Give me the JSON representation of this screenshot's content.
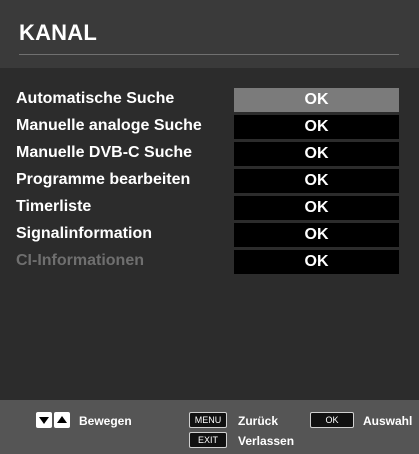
{
  "title": "KANAL",
  "menu": {
    "items": [
      {
        "label": "Automatische Suche",
        "action": "OK",
        "selected": true,
        "enabled": true
      },
      {
        "label": "Manuelle analoge Suche",
        "action": "OK",
        "selected": false,
        "enabled": true
      },
      {
        "label": "Manuelle DVB-C Suche",
        "action": "OK",
        "selected": false,
        "enabled": true
      },
      {
        "label": "Programme bearbeiten",
        "action": "OK",
        "selected": false,
        "enabled": true
      },
      {
        "label": "Timerliste",
        "action": "OK",
        "selected": false,
        "enabled": true
      },
      {
        "label": "Signalinformation",
        "action": "OK",
        "selected": false,
        "enabled": true
      },
      {
        "label": "CI-Informationen",
        "action": "OK",
        "selected": false,
        "enabled": false
      }
    ]
  },
  "footer": {
    "move_label": "Bewegen",
    "menu_key": "MENU",
    "back_label": "Zurück",
    "exit_key": "EXIT",
    "exit_label": "Verlassen",
    "ok_key": "OK",
    "select_label": "Auswahl",
    "icons": [
      "arrow-down-key-icon",
      "arrow-up-key-icon"
    ]
  },
  "colors": {
    "background": "#2c2c2c",
    "selected_button": "#7b7b7b",
    "button": "#000000",
    "disabled_text": "#6f6f6f",
    "footer": "#555555"
  }
}
